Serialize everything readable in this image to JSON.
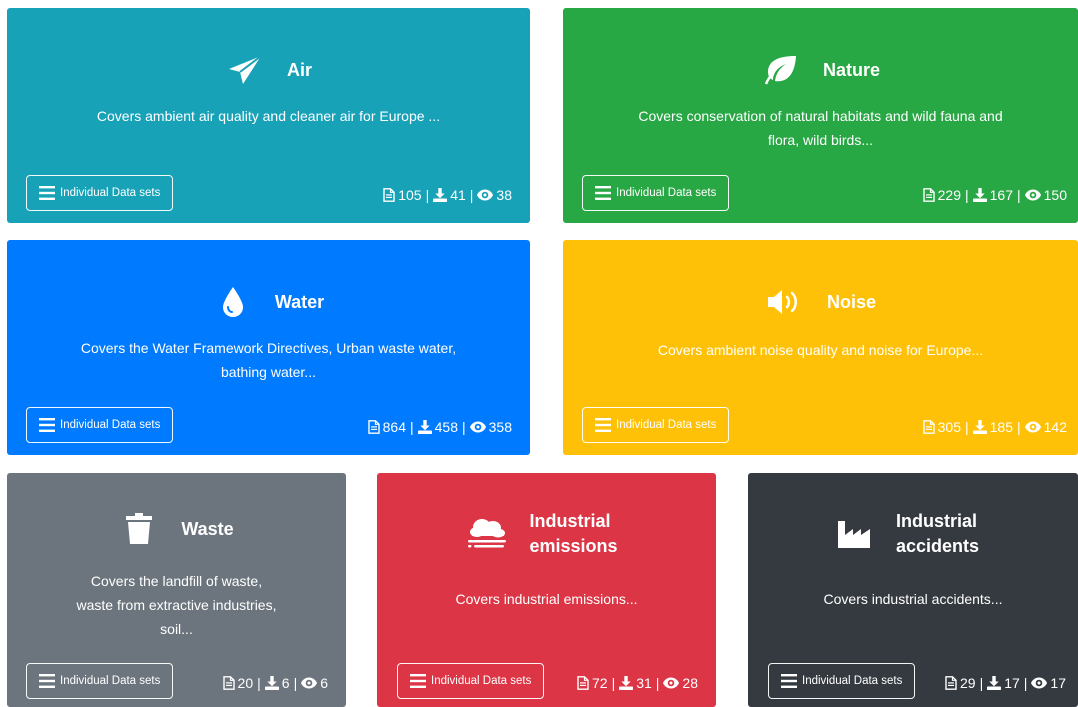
{
  "cards": [
    {
      "title": "Air",
      "description": "Covers ambient air quality and cleaner air for Europe ...",
      "button": "Individual Data sets",
      "files": "105",
      "downloads": "41",
      "views": "38",
      "icon": "paper-plane-icon",
      "color": "#17a2b8"
    },
    {
      "title": "Nature",
      "description": "Covers conservation of natural habitats and wild fauna and flora, wild birds...",
      "button": "Individual Data sets",
      "files": "229",
      "downloads": "167",
      "views": "150",
      "icon": "leaf-icon",
      "color": "#28a745"
    },
    {
      "title": "Water",
      "description": "Covers the Water Framework Directives, Urban waste water, bathing water...",
      "button": "Individual Data sets",
      "files": "864",
      "downloads": "458",
      "views": "358",
      "icon": "water-drop-icon",
      "color": "#007bff"
    },
    {
      "title": "Noise",
      "description": "Covers ambient noise quality and noise for Europe...",
      "button": "Individual Data sets",
      "files": "305",
      "downloads": "185",
      "views": "142",
      "icon": "volume-up-icon",
      "color": "#ffc107"
    },
    {
      "title": "Waste",
      "description": "Covers the landfill of waste, waste from extractive industries, soil...",
      "button": "Individual Data sets",
      "files": "20",
      "downloads": "6",
      "views": "6",
      "icon": "trash-icon",
      "color": "#6c757d"
    },
    {
      "title": "Industrial emissions",
      "description": "Covers industrial emissions...",
      "button": "Individual Data sets",
      "files": "72",
      "downloads": "31",
      "views": "28",
      "icon": "smog-icon",
      "color": "#dc3545"
    },
    {
      "title": "Industrial accidents",
      "description": "Covers industrial accidents...",
      "button": "Individual Data sets",
      "files": "29",
      "downloads": "17",
      "views": "17",
      "icon": "industry-icon",
      "color": "#343a40"
    }
  ],
  "separator": "|"
}
